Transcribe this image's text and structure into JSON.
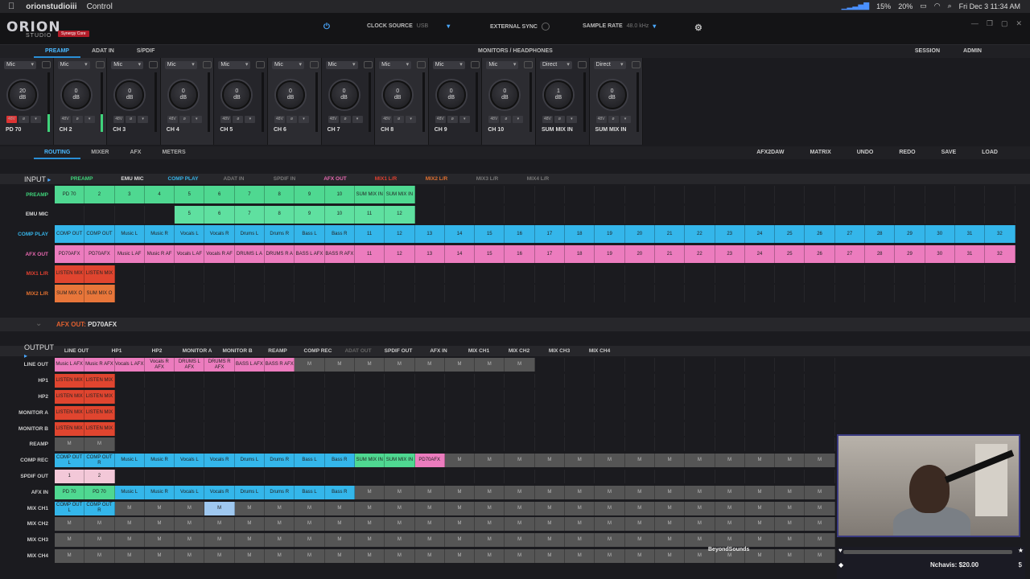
{
  "menubar": {
    "app": "orionstudioiii",
    "menu": "Control",
    "battery1": "15%",
    "battery2": "20%",
    "clock": "Fri Dec 3  11:34 AM"
  },
  "title": {
    "logo": "ORION",
    "sub": "STUDIO",
    "badge": "Synergy Core",
    "clock_source_label": "CLOCK SOURCE",
    "clock_source": "USB",
    "ext_sync": "EXTERNAL SYNC",
    "sample_rate_label": "SAMPLE RATE",
    "sample_rate": "48.0 kHz"
  },
  "tabs": {
    "preamp": "PREAMP",
    "adat": "ADAT IN",
    "spdif": "S/PDIF",
    "monitors": "MONITORS / HEADPHONES",
    "session": "SESSION",
    "admin": "ADMIN"
  },
  "strips": [
    {
      "input": "Mic",
      "gain": "20\ndB",
      "name": "PD 70",
      "meter": true,
      "p48": true
    },
    {
      "input": "Mic",
      "gain": "0\ndB",
      "name": "CH 2",
      "meter": true,
      "p48": false
    },
    {
      "input": "Mic",
      "gain": "0\ndB",
      "name": "CH 3",
      "meter": false,
      "p48": false
    },
    {
      "input": "Mic",
      "gain": "0\ndB",
      "name": "CH 4",
      "meter": false,
      "p48": false
    },
    {
      "input": "Mic",
      "gain": "0\ndB",
      "name": "CH 5",
      "meter": false,
      "p48": false
    },
    {
      "input": "Mic",
      "gain": "0\ndB",
      "name": "CH 6",
      "meter": false,
      "p48": false
    },
    {
      "input": "Mic",
      "gain": "0\ndB",
      "name": "CH 7",
      "meter": false,
      "p48": false
    },
    {
      "input": "Mic",
      "gain": "0\ndB",
      "name": "CH 8",
      "meter": false,
      "p48": false
    },
    {
      "input": "Mic",
      "gain": "0\ndB",
      "name": "CH 9",
      "meter": false,
      "p48": false
    },
    {
      "input": "Mic",
      "gain": "0\ndB",
      "name": "CH 10",
      "meter": false,
      "p48": false
    },
    {
      "input": "Direct",
      "gain": "1\ndB",
      "name": "SUM MIX IN",
      "meter": false,
      "p48": false
    },
    {
      "input": "Direct",
      "gain": "0\ndB",
      "name": "SUM MIX IN",
      "meter": false,
      "p48": false
    }
  ],
  "subtabs": {
    "routing": "ROUTING",
    "mixer": "MIXER",
    "afx": "AFX",
    "meters": "METERS",
    "afx2daw": "AFX2DAW",
    "matrix": "MATRIX",
    "undo": "UNDO",
    "redo": "REDO",
    "save": "SAVE",
    "load": "LOAD"
  },
  "input": {
    "label": "INPUT",
    "sources": [
      {
        "t": "PREAMP",
        "c": "#3fd37a"
      },
      {
        "t": "EMU MIC",
        "c": "#dddddd"
      },
      {
        "t": "COMP PLAY",
        "c": "#36b4e8"
      },
      {
        "t": "ADAT IN",
        "c": "#777777"
      },
      {
        "t": "SPDIF IN",
        "c": "#777777"
      },
      {
        "t": "AFX OUT",
        "c": "#e868b0"
      },
      {
        "t": "MIX1 L/R",
        "c": "#e04030"
      },
      {
        "t": "MIX2 L/R",
        "c": "#e07030"
      },
      {
        "t": "MIX3 L/R",
        "c": "#777777"
      },
      {
        "t": "MIX4 L/R",
        "c": "#777777"
      }
    ],
    "rows": [
      {
        "label": "PREAMP",
        "color": "#3fd37a",
        "bg": "#4fd891",
        "start": 0,
        "cells": [
          "PD 70",
          "2",
          "3",
          "4",
          "5",
          "6",
          "7",
          "8",
          "9",
          "10",
          "SUM MIX IN",
          "SUM MIX IN"
        ]
      },
      {
        "label": "EMU MIC",
        "color": "#dddddd",
        "bg": "#5fe0a0",
        "start": 4,
        "cells": [
          "5",
          "6",
          "7",
          "8",
          "9",
          "10",
          "11",
          "12"
        ]
      },
      {
        "label": "COMP PLAY",
        "color": "#36b4e8",
        "bg": "#34b6ea",
        "start": 0,
        "cells": [
          "COMP OUT",
          "COMP OUT",
          "Music L",
          "Music R",
          "Vocals L",
          "Vocals R",
          "Drums L",
          "Drums R",
          "Bass L",
          "Bass R",
          "11",
          "12",
          "13",
          "14",
          "15",
          "16",
          "17",
          "18",
          "19",
          "20",
          "21",
          "22",
          "23",
          "24",
          "25",
          "26",
          "27",
          "28",
          "29",
          "30",
          "31",
          "32"
        ]
      },
      {
        "label": "AFX OUT",
        "color": "#e868b0",
        "bg": "#ec7cbe",
        "start": 0,
        "cells": [
          "PD70AFX",
          "PD70AFX",
          "Music L AF",
          "Music R AF",
          "Vocals L AF",
          "Vocals R AF",
          "DRUMS L A",
          "DRUMS R A",
          "BASS L AFX",
          "BASS R AFX",
          "11",
          "12",
          "13",
          "14",
          "15",
          "16",
          "17",
          "18",
          "19",
          "20",
          "21",
          "22",
          "23",
          "24",
          "25",
          "26",
          "27",
          "28",
          "29",
          "30",
          "31",
          "32"
        ]
      },
      {
        "label": "MIX1 L/R",
        "color": "#e04030",
        "bg": "#e0452f",
        "start": 0,
        "cells": [
          "LISTEN MIX",
          "LISTEN MIX"
        ]
      },
      {
        "label": "MIX2 L/R",
        "color": "#e07030",
        "bg": "#e8763a",
        "start": 0,
        "cells": [
          "SUM MIX O",
          "SUM MIX O"
        ]
      }
    ]
  },
  "afx": {
    "label": "AFX OUT:",
    "value": "PD70AFX"
  },
  "output": {
    "label": "OUTPUT",
    "tabs": [
      "LINE OUT",
      "HP1",
      "HP2",
      "MONITOR A",
      "MONITOR B",
      "REAMP",
      "COMP REC",
      "ADAT OUT",
      "SPDIF OUT",
      "AFX IN",
      "MIX CH1",
      "MIX CH2",
      "MIX CH3",
      "MIX CH4"
    ],
    "rows": [
      {
        "label": "LINE OUT",
        "cells": [
          [
            "Music L AFX",
            "#ec7cbe"
          ],
          [
            "Music R AFX",
            "#ec7cbe"
          ],
          [
            "Vocals L AFX",
            "#ec7cbe"
          ],
          [
            "Vocals R AFX",
            "#ec7cbe"
          ],
          [
            "DRUMS L AFX",
            "#ec7cbe"
          ],
          [
            "DRUMS R AFX",
            "#ec7cbe"
          ],
          [
            "BASS L AFX",
            "#ec7cbe"
          ],
          [
            "BASS R AFX",
            "#ec7cbe"
          ],
          [
            "M",
            "#555"
          ],
          [
            "M",
            "#555"
          ],
          [
            "M",
            "#555"
          ],
          [
            "M",
            "#555"
          ],
          [
            "M",
            "#555"
          ],
          [
            "M",
            "#555"
          ],
          [
            "M",
            "#555"
          ],
          [
            "M",
            "#555"
          ]
        ]
      },
      {
        "label": "HP1",
        "cells": [
          [
            "LISTEN MIX",
            "#e0452f"
          ],
          [
            "LISTEN MIX",
            "#e0452f"
          ]
        ]
      },
      {
        "label": "HP2",
        "cells": [
          [
            "LISTEN MIX",
            "#e0452f"
          ],
          [
            "LISTEN MIX",
            "#e0452f"
          ]
        ]
      },
      {
        "label": "MONITOR A",
        "cells": [
          [
            "LISTEN MIX",
            "#e0452f"
          ],
          [
            "LISTEN MIX",
            "#e0452f"
          ]
        ]
      },
      {
        "label": "MONITOR B",
        "cells": [
          [
            "LISTEN MIX",
            "#e0452f"
          ],
          [
            "LISTEN MIX",
            "#e0452f"
          ]
        ]
      },
      {
        "label": "REAMP",
        "cells": [
          [
            "M",
            "#555"
          ],
          [
            "M",
            "#555"
          ]
        ]
      },
      {
        "label": "COMP REC",
        "cells": [
          [
            "COMP OUT L",
            "#34b6ea"
          ],
          [
            "COMP OUT R",
            "#34b6ea"
          ],
          [
            "Music L",
            "#34b6ea"
          ],
          [
            "Music R",
            "#34b6ea"
          ],
          [
            "Vocals L",
            "#34b6ea"
          ],
          [
            "Vocals R",
            "#34b6ea"
          ],
          [
            "Drums L",
            "#34b6ea"
          ],
          [
            "Drums R",
            "#34b6ea"
          ],
          [
            "Bass L",
            "#34b6ea"
          ],
          [
            "Bass R",
            "#34b6ea"
          ],
          [
            "SUM MIX IN",
            "#4fd891"
          ],
          [
            "SUM MIX IN",
            "#4fd891"
          ],
          [
            "PD70AFX",
            "#ec7cbe"
          ],
          [
            "M",
            "#555"
          ],
          [
            "M",
            "#555"
          ],
          [
            "M",
            "#555"
          ],
          [
            "M",
            "#555"
          ],
          [
            "M",
            "#555"
          ],
          [
            "M",
            "#555"
          ],
          [
            "M",
            "#555"
          ],
          [
            "M",
            "#555"
          ],
          [
            "M",
            "#555"
          ],
          [
            "M",
            "#555"
          ],
          [
            "M",
            "#555"
          ],
          [
            "M",
            "#555"
          ],
          [
            "M",
            "#555"
          ],
          [
            "M",
            "#555"
          ]
        ]
      },
      {
        "label": "SPDIF OUT",
        "cells": [
          [
            "1",
            "#f3c8d8"
          ],
          [
            "2",
            "#f3c8d8"
          ]
        ]
      },
      {
        "label": "AFX IN",
        "cells": [
          [
            "PD 70",
            "#4fd891"
          ],
          [
            "PD 70",
            "#4fd891"
          ],
          [
            "Music L",
            "#34b6ea"
          ],
          [
            "Music R",
            "#34b6ea"
          ],
          [
            "Vocals L",
            "#34b6ea"
          ],
          [
            "Vocals R",
            "#34b6ea"
          ],
          [
            "Drums L",
            "#34b6ea"
          ],
          [
            "Drums R",
            "#34b6ea"
          ],
          [
            "Bass L",
            "#34b6ea"
          ],
          [
            "Bass R",
            "#34b6ea"
          ],
          [
            "M",
            "#555"
          ],
          [
            "M",
            "#555"
          ],
          [
            "M",
            "#555"
          ],
          [
            "M",
            "#555"
          ],
          [
            "M",
            "#555"
          ],
          [
            "M",
            "#555"
          ],
          [
            "M",
            "#555"
          ],
          [
            "M",
            "#555"
          ],
          [
            "M",
            "#555"
          ],
          [
            "M",
            "#555"
          ],
          [
            "M",
            "#555"
          ],
          [
            "M",
            "#555"
          ],
          [
            "M",
            "#555"
          ],
          [
            "M",
            "#555"
          ],
          [
            "M",
            "#555"
          ],
          [
            "M",
            "#555"
          ],
          [
            "M",
            "#555"
          ]
        ]
      },
      {
        "label": "MIX CH1",
        "cells": [
          [
            "COMP OUT L",
            "#34b6ea"
          ],
          [
            "COMP OUT R",
            "#34b6ea"
          ],
          [
            "M",
            "#555"
          ],
          [
            "M",
            "#555"
          ],
          [
            "M",
            "#555"
          ],
          [
            "M",
            "#9fc8f0"
          ],
          [
            "M",
            "#555"
          ],
          [
            "M",
            "#555"
          ],
          [
            "M",
            "#555"
          ],
          [
            "M",
            "#555"
          ],
          [
            "M",
            "#555"
          ],
          [
            "M",
            "#555"
          ],
          [
            "M",
            "#555"
          ],
          [
            "M",
            "#555"
          ],
          [
            "M",
            "#555"
          ],
          [
            "M",
            "#555"
          ],
          [
            "M",
            "#555"
          ],
          [
            "M",
            "#555"
          ],
          [
            "M",
            "#555"
          ],
          [
            "M",
            "#555"
          ],
          [
            "M",
            "#555"
          ],
          [
            "M",
            "#555"
          ],
          [
            "M",
            "#555"
          ],
          [
            "M",
            "#555"
          ],
          [
            "M",
            "#555"
          ],
          [
            "M",
            "#555"
          ],
          [
            "M",
            "#555"
          ]
        ]
      },
      {
        "label": "MIX CH2",
        "cells": [
          [
            "M",
            "#555"
          ],
          [
            "M",
            "#555"
          ],
          [
            "M",
            "#555"
          ],
          [
            "M",
            "#555"
          ],
          [
            "M",
            "#555"
          ],
          [
            "M",
            "#555"
          ],
          [
            "M",
            "#555"
          ],
          [
            "M",
            "#555"
          ],
          [
            "M",
            "#555"
          ],
          [
            "M",
            "#555"
          ],
          [
            "M",
            "#555"
          ],
          [
            "M",
            "#555"
          ],
          [
            "M",
            "#555"
          ],
          [
            "M",
            "#555"
          ],
          [
            "M",
            "#555"
          ],
          [
            "M",
            "#555"
          ],
          [
            "M",
            "#555"
          ],
          [
            "M",
            "#555"
          ],
          [
            "M",
            "#555"
          ],
          [
            "M",
            "#555"
          ],
          [
            "M",
            "#555"
          ],
          [
            "M",
            "#555"
          ],
          [
            "M",
            "#555"
          ],
          [
            "M",
            "#555"
          ],
          [
            "M",
            "#555"
          ],
          [
            "M",
            "#555"
          ],
          [
            "M",
            "#555"
          ]
        ]
      },
      {
        "label": "MIX CH3",
        "cells": [
          [
            "M",
            "#555"
          ],
          [
            "M",
            "#555"
          ],
          [
            "M",
            "#555"
          ],
          [
            "M",
            "#555"
          ],
          [
            "M",
            "#555"
          ],
          [
            "M",
            "#555"
          ],
          [
            "M",
            "#555"
          ],
          [
            "M",
            "#555"
          ],
          [
            "M",
            "#555"
          ],
          [
            "M",
            "#555"
          ],
          [
            "M",
            "#555"
          ],
          [
            "M",
            "#555"
          ],
          [
            "M",
            "#555"
          ],
          [
            "M",
            "#555"
          ],
          [
            "M",
            "#555"
          ],
          [
            "M",
            "#555"
          ],
          [
            "M",
            "#555"
          ],
          [
            "M",
            "#555"
          ],
          [
            "M",
            "#555"
          ],
          [
            "M",
            "#555"
          ],
          [
            "M",
            "#555"
          ],
          [
            "M",
            "#555"
          ],
          [
            "M",
            "#555"
          ],
          [
            "M",
            "#555"
          ],
          [
            "M",
            "#555"
          ],
          [
            "M",
            "#555"
          ],
          [
            "M",
            "#555"
          ]
        ]
      },
      {
        "label": "MIX CH4",
        "cells": [
          [
            "M",
            "#555"
          ],
          [
            "M",
            "#555"
          ],
          [
            "M",
            "#555"
          ],
          [
            "M",
            "#555"
          ],
          [
            "M",
            "#555"
          ],
          [
            "M",
            "#555"
          ],
          [
            "M",
            "#555"
          ],
          [
            "M",
            "#555"
          ],
          [
            "M",
            "#555"
          ],
          [
            "M",
            "#555"
          ],
          [
            "M",
            "#555"
          ],
          [
            "M",
            "#555"
          ],
          [
            "M",
            "#555"
          ],
          [
            "M",
            "#555"
          ],
          [
            "M",
            "#555"
          ],
          [
            "M",
            "#555"
          ],
          [
            "M",
            "#555"
          ],
          [
            "M",
            "#555"
          ],
          [
            "M",
            "#555"
          ],
          [
            "M",
            "#555"
          ],
          [
            "M",
            "#555"
          ],
          [
            "M",
            "#555"
          ],
          [
            "M",
            "#555"
          ],
          [
            "M",
            "#555"
          ],
          [
            "M",
            "#555"
          ],
          [
            "M",
            "#555"
          ],
          [
            "M",
            "#555"
          ]
        ]
      }
    ]
  },
  "overlay": {
    "brand": "BeyondSounds",
    "donation": "Nchavis: $20.00"
  }
}
